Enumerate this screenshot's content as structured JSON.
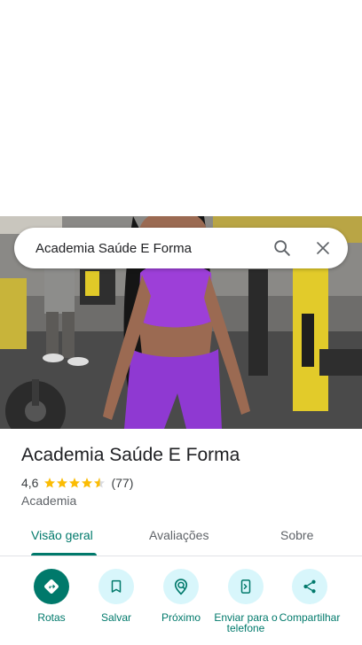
{
  "search": {
    "query": "Academia Saúde E Forma"
  },
  "place": {
    "name": "Academia Saúde E Forma",
    "rating_value": "4,6",
    "rating_stars": 4.6,
    "review_count": "(77)",
    "category": "Academia"
  },
  "tabs": [
    {
      "label": "Visão geral",
      "active": true
    },
    {
      "label": "Avaliações",
      "active": false
    },
    {
      "label": "Sobre",
      "active": false
    }
  ],
  "actions": [
    {
      "label": "Rotas",
      "icon": "directions-icon"
    },
    {
      "label": "Salvar",
      "icon": "bookmark-icon"
    },
    {
      "label": "Próximo",
      "icon": "nearby-icon"
    },
    {
      "label": "Enviar para o telefone",
      "icon": "send-to-phone-icon"
    },
    {
      "label": "Compartilhar",
      "icon": "share-icon"
    }
  ],
  "colors": {
    "accent": "#00796b",
    "action_bg": "#d8f6fb",
    "star": "#fbbc04"
  }
}
